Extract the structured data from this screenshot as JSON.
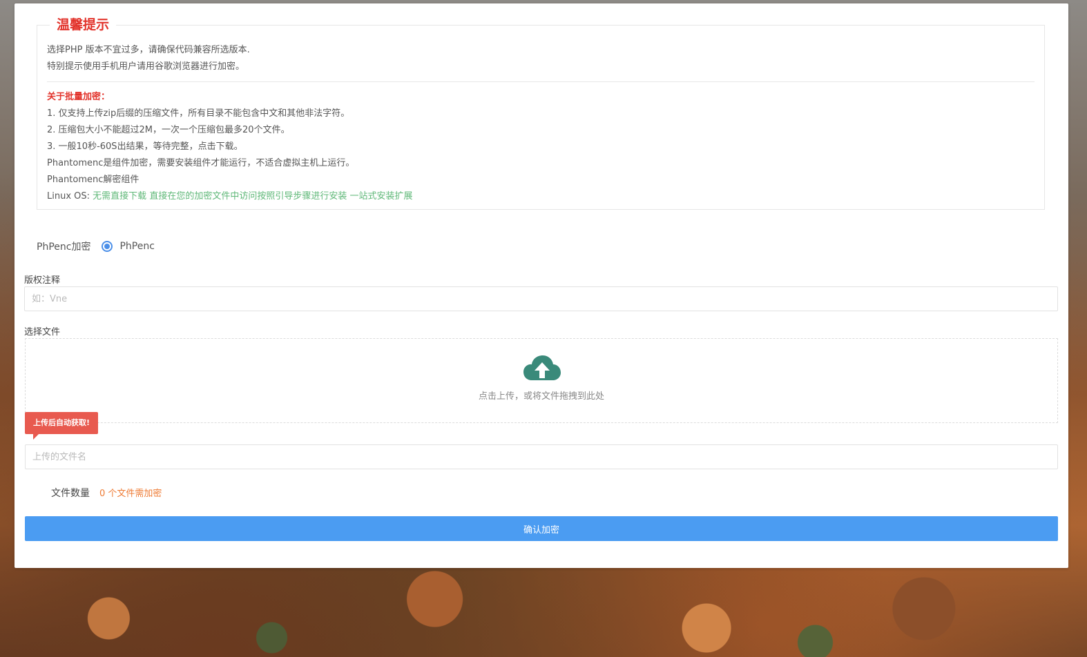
{
  "notice": {
    "title": "温馨提示",
    "line1": "选择PHP 版本不宜过多，请确保代码兼容所选版本.",
    "line2": "特别提示使用手机用户请用谷歌浏览器进行加密。",
    "batch_title": "关于批量加密：",
    "batch1": "1. 仅支持上传zip后缀的压缩文件，所有目录不能包含中文和其他非法字符。",
    "batch2": "2. 压缩包大小不能超过2M，一次一个压缩包最多20个文件。",
    "batch3": "3. 一般10秒-60S出结果，等待完整，点击下载。",
    "phantom1": "Phantomenc是组件加密，需要安装组件才能运行，不适合虚拟主机上运行。",
    "phantom2": "Phantomenc解密组件",
    "linux_prefix": "Linux OS: ",
    "link1": "无需直接下载",
    "link2": "直接在您的加密文件中访问按照引导步骤进行安装",
    "link3": "一站式安装扩展"
  },
  "encrypt_type": {
    "label": "PhPenc加密",
    "option": "PhPenc"
  },
  "copyright": {
    "label": "版权注释",
    "placeholder": "如：Vne"
  },
  "file": {
    "label": "选择文件",
    "drop_text": "点击上传，或将文件拖拽到此处",
    "tip": "上传后自动获取!",
    "filename_placeholder": "上传的文件名"
  },
  "count": {
    "label": "文件数量",
    "value": "0 个文件需加密"
  },
  "submit_label": "确认加密",
  "colors": {
    "accent": "#4b9cf2",
    "danger": "#e2322a",
    "link_green": "#5fb878",
    "cloud": "#3a8a7a"
  }
}
